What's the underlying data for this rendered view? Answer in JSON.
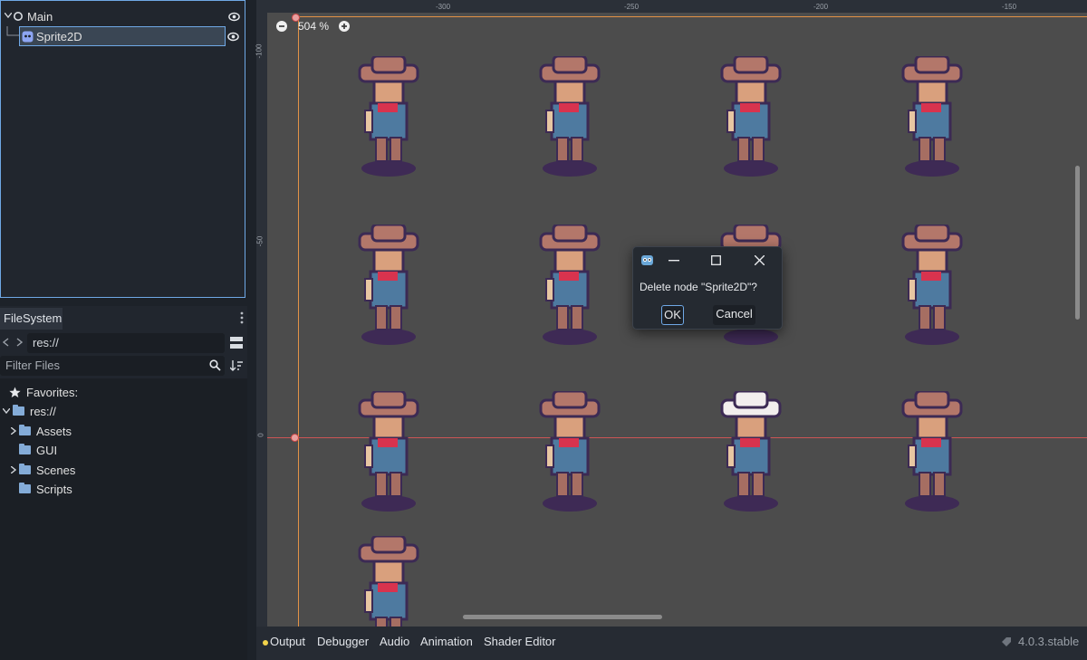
{
  "scene_tree": {
    "root": {
      "label": "Main"
    },
    "child": {
      "label": "Sprite2D"
    }
  },
  "filesystem": {
    "tab_label": "FileSystem",
    "path_value": "res://",
    "filter_placeholder": "Filter Files",
    "favorites_label": "Favorites:",
    "root_label": "res://",
    "folders": [
      "Assets",
      "GUI",
      "Scenes",
      "Scripts"
    ]
  },
  "viewport": {
    "zoom_label": "504 %",
    "ruler_top_ticks": [
      "-300",
      "-250",
      "-200",
      "-150"
    ],
    "ruler_left_ticks": [
      "-100",
      "-50",
      "0"
    ]
  },
  "dialog": {
    "message": "Delete node \"Sprite2D\"?",
    "ok_label": "OK",
    "cancel_label": "Cancel"
  },
  "bottom_panel": {
    "tabs": [
      "Output",
      "Debugger",
      "Audio",
      "Animation",
      "Shader Editor"
    ],
    "version": "4.0.3.stable"
  },
  "colors": {
    "accent": "#6fa8e6",
    "output_dot": "#f2d34b",
    "viewport_bg": "#4c4c4c"
  }
}
